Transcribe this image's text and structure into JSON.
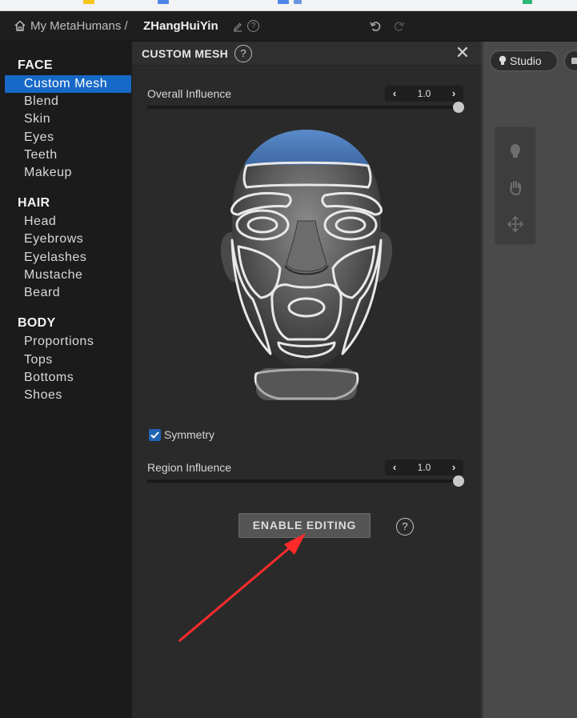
{
  "breadcrumb": {
    "root": "My MetaHumans",
    "separator": "/",
    "current": "ZHangHuiYin"
  },
  "icons": {
    "home": "home-icon",
    "edit": "edit-pencil-icon",
    "help": "help-circle-icon",
    "undo": "undo-icon",
    "redo": "redo-icon",
    "close": "close-icon",
    "studio": "light-bulb-icon",
    "tools": [
      "head-tool-icon",
      "hand-tool-icon",
      "move-tool-icon"
    ]
  },
  "sidebar": {
    "sections": [
      {
        "title": "FACE",
        "items": [
          "Custom Mesh",
          "Blend",
          "Skin",
          "Eyes",
          "Teeth",
          "Makeup"
        ]
      },
      {
        "title": "HAIR",
        "items": [
          "Head",
          "Eyebrows",
          "Eyelashes",
          "Mustache",
          "Beard"
        ]
      },
      {
        "title": "BODY",
        "items": [
          "Proportions",
          "Tops",
          "Bottoms",
          "Shoes"
        ]
      }
    ],
    "active_item": "Custom Mesh"
  },
  "panel": {
    "title": "CUSTOM MESH",
    "help": "?",
    "close": "✕",
    "overall_influence": {
      "label": "Overall Influence",
      "value": "1.0",
      "fraction": 1.0
    },
    "symmetry": {
      "label": "Symmetry",
      "checked": true
    },
    "region_influence": {
      "label": "Region Influence",
      "value": "1.0",
      "fraction": 1.0
    },
    "enable_editing_label": "ENABLE EDITING",
    "enable_help": "?"
  },
  "viewport": {
    "studio_label": "Studio"
  },
  "colors": {
    "accent": "#1769c7",
    "selected_region": "#4b79b8",
    "annotation_arrow": "#ff2b2b"
  }
}
